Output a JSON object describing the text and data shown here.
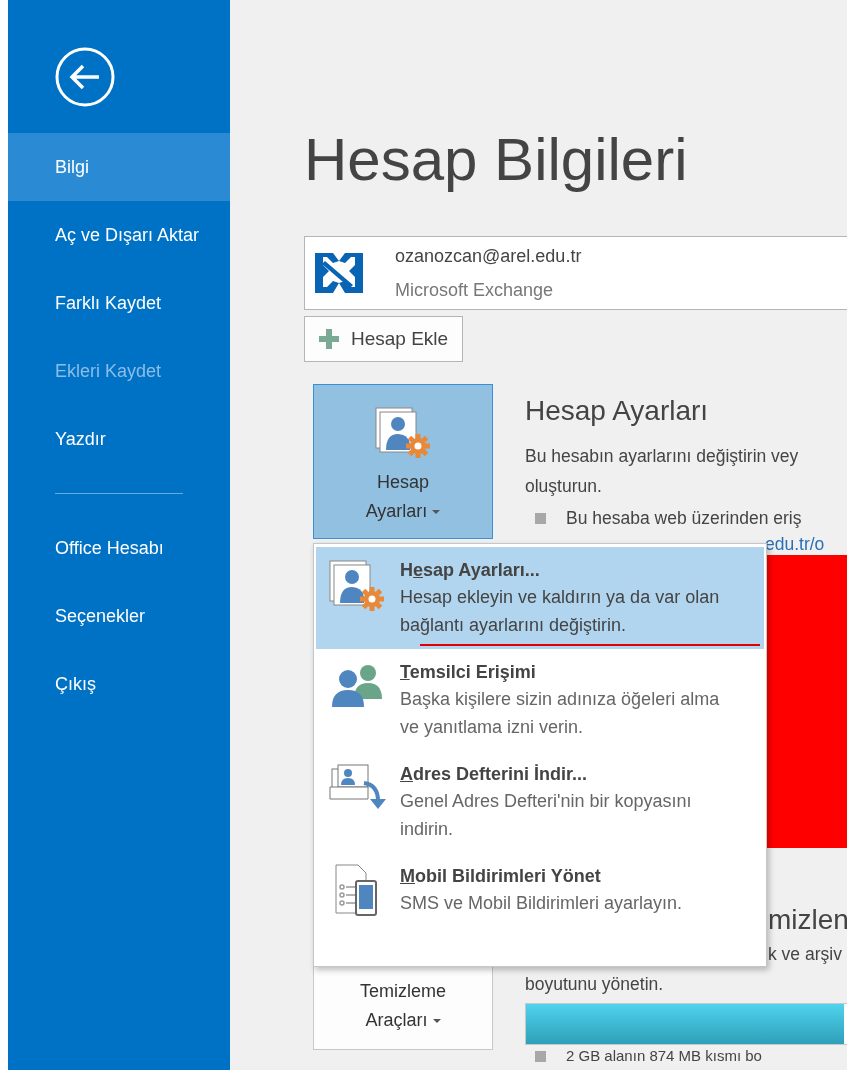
{
  "sidebar": {
    "items": [
      {
        "label": "Bilgi",
        "selected": true,
        "disabled": false
      },
      {
        "label": "Aç ve Dışarı Aktar",
        "selected": false,
        "disabled": false
      },
      {
        "label": "Farklı Kaydet",
        "selected": false,
        "disabled": false
      },
      {
        "label": "Ekleri Kaydet",
        "selected": false,
        "disabled": true
      },
      {
        "label": "Yazdır",
        "selected": false,
        "disabled": false
      }
    ],
    "footer_items": [
      {
        "label": "Office Hesabı",
        "selected": false,
        "disabled": false
      },
      {
        "label": "Seçenekler",
        "selected": false,
        "disabled": false
      },
      {
        "label": "Çıkış",
        "selected": false,
        "disabled": false
      }
    ]
  },
  "page_title": "Hesap Bilgileri",
  "account": {
    "email": "ozanozcan@arel.edu.tr",
    "type": "Microsoft Exchange"
  },
  "add_account_button": "Hesap Ekle",
  "account_settings": {
    "button_lines": [
      "Hesap",
      "Ayarları"
    ],
    "expanded": true,
    "heading": "Hesap Ayarları",
    "description_lines": [
      "Bu hesabın ayarlarını değiştirin vey",
      "oluşturun."
    ],
    "bullet": "Bu hesaba web üzerinden eriş",
    "link_fragment": "edu.tr/o"
  },
  "menu": [
    {
      "kind": "settings",
      "title_before": "H",
      "mnemonic": "e",
      "title_after": "sap Ayarları...",
      "description": "Hesap ekleyin ve kaldırın ya da var olan bağlantı ayarlarını değiştirin.",
      "selected": true,
      "annotated": true
    },
    {
      "kind": "delegates",
      "mnemonic": "T",
      "title_after": "emsilci Erişimi",
      "description": "Başka kişilere sizin adınıza öğeleri alma ve yanıtlama izni verin.",
      "selected": false,
      "annotated": false
    },
    {
      "kind": "addressbook",
      "mnemonic": "A",
      "title_after": "dres Defterini İndir...",
      "description": "Genel Adres Defteri'nin bir kopyasını indirin.",
      "selected": false,
      "annotated": false
    },
    {
      "kind": "mobile",
      "mnemonic": "M",
      "title_after": "obil Bildirimleri Yönet",
      "description": "SMS ve Mobil Bildirimleri ayarlayın.",
      "selected": false,
      "annotated": false
    }
  ],
  "cleanup": {
    "button_lines": [
      "Temizleme",
      "Araçları"
    ],
    "heading_fragment": "mizlen",
    "description_fragment": "k ve arşiv",
    "description_line": "boyutunu yönetin.",
    "storage": {
      "level": 0.8
    },
    "storage_text": "2 GB alanın 874 MB kısmı bo"
  }
}
